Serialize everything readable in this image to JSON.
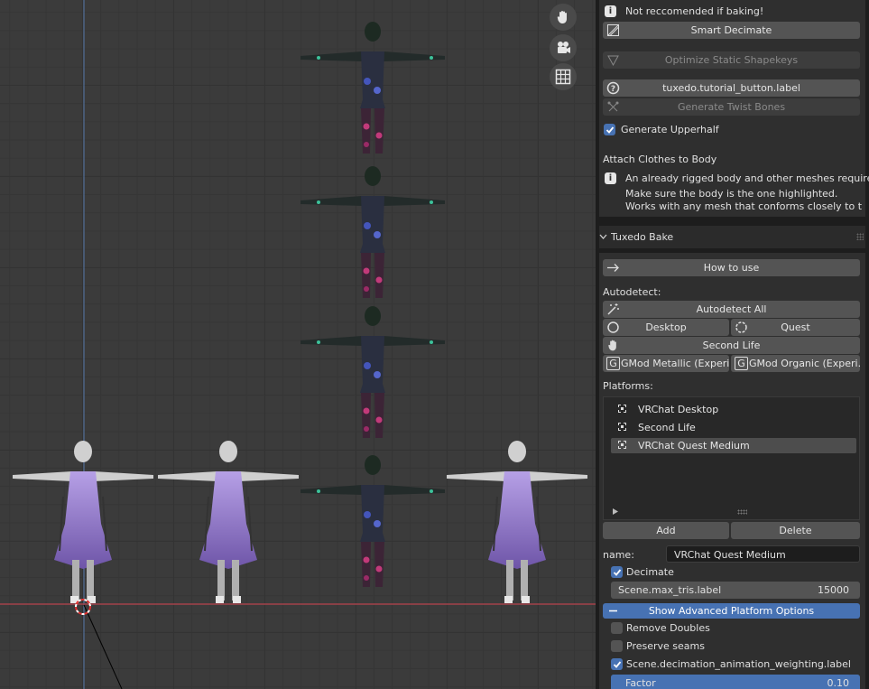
{
  "panel": {
    "info_baking": "Not reccomended if baking!",
    "smart_decimate": "Smart Decimate",
    "optimize_shapekeys": "Optimize Static Shapekeys",
    "tutorial_button": "tuxedo.tutorial_button.label",
    "generate_twist": "Generate Twist Bones",
    "generate_upperhalf": "Generate Upperhalf",
    "attach_title": "Attach Clothes to Body",
    "attach_info_1": "An already rigged body and other meshes required!",
    "attach_info_2": "Make sure the body is the one highlighted.",
    "attach_info_3": "Works with any mesh that conforms closely to the ..."
  },
  "bake": {
    "title": "Tuxedo Bake",
    "how_to_use": "How to use",
    "autodetect_label": "Autodetect:",
    "autodetect_all": "Autodetect All",
    "desktop": "Desktop",
    "quest": "Quest",
    "second_life": "Second Life",
    "gmod_metallic": "GMod Metallic (Experi...",
    "gmod_organic": "GMod Organic (Experi...",
    "platforms_label": "Platforms:",
    "platforms": [
      "VRChat Desktop",
      "Second Life",
      "VRChat Quest Medium"
    ],
    "selected_platform": "VRChat Quest Medium",
    "add": "Add",
    "delete": "Delete",
    "name_label": "name:",
    "name_value": "VRChat Quest Medium",
    "decimate": "Decimate",
    "max_tris_label": "Scene.max_tris.label",
    "max_tris_value": "15000",
    "advanced_options": "Show Advanced Platform Options",
    "remove_doubles": "Remove Doubles",
    "preserve_seams": "Preserve seams",
    "anim_weighting": "Scene.decimation_animation_weighting.label",
    "factor_label": "Factor",
    "factor_value": "0.10"
  },
  "colors": {
    "accent": "#4772b3",
    "panel_bg": "#1d1d1d",
    "button": "#545454"
  },
  "icons": [
    "hand-icon",
    "camera-icon",
    "grid-icon",
    "info-icon",
    "decimate-icon",
    "shapekey-icon",
    "help-icon",
    "bone-icon",
    "arrow-right-icon",
    "wand-icon",
    "circle-icon",
    "gmod-icon"
  ]
}
